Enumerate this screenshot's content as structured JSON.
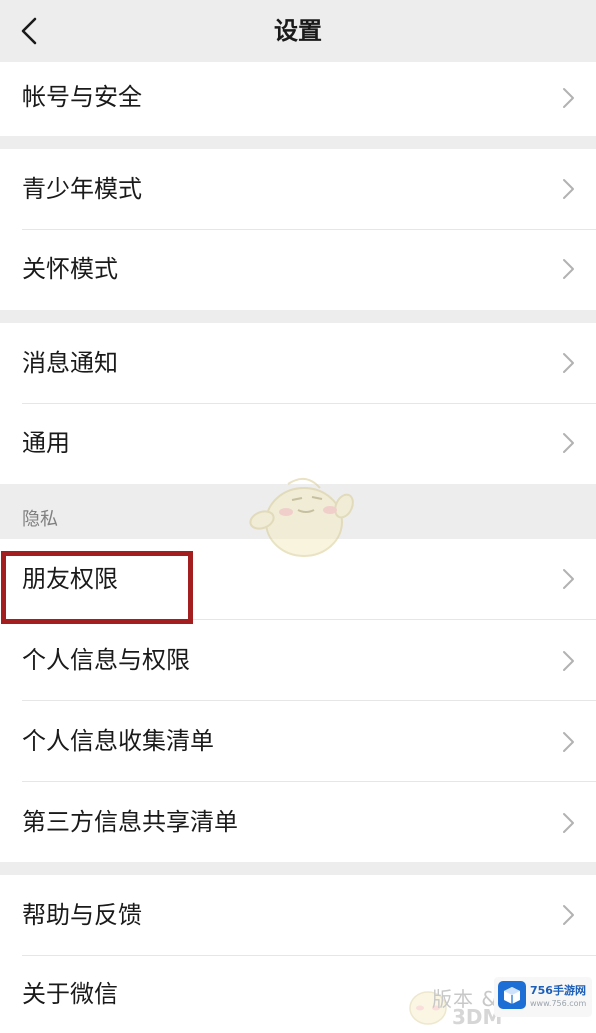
{
  "header": {
    "title": "设置",
    "back_icon": "chevron-left-icon"
  },
  "groups": [
    {
      "items": [
        {
          "label": "帐号与安全"
        }
      ]
    },
    {
      "items": [
        {
          "label": "青少年模式"
        },
        {
          "label": "关怀模式"
        }
      ]
    },
    {
      "items": [
        {
          "label": "消息通知"
        },
        {
          "label": "通用"
        }
      ]
    },
    {
      "section_label": "隐私",
      "items": [
        {
          "label": "朋友权限",
          "highlighted": true
        },
        {
          "label": "个人信息与权限"
        },
        {
          "label": "个人信息收集清单"
        },
        {
          "label": "第三方信息共享清单"
        }
      ]
    },
    {
      "items": [
        {
          "label": "帮助与反馈"
        },
        {
          "label": "关于微信"
        }
      ]
    }
  ],
  "row_icon": "chevron-right-icon",
  "watermark": {
    "text_cn": "版本 &",
    "text_3dm": "3DM",
    "brand_name": "756手游网",
    "brand_url": "www.756.com"
  },
  "colors": {
    "background": "#ededed",
    "row_background": "#ffffff",
    "highlight_border": "#a31e1e",
    "chevron": "#b2b2b2",
    "brand_blue": "#1d5fb8"
  }
}
